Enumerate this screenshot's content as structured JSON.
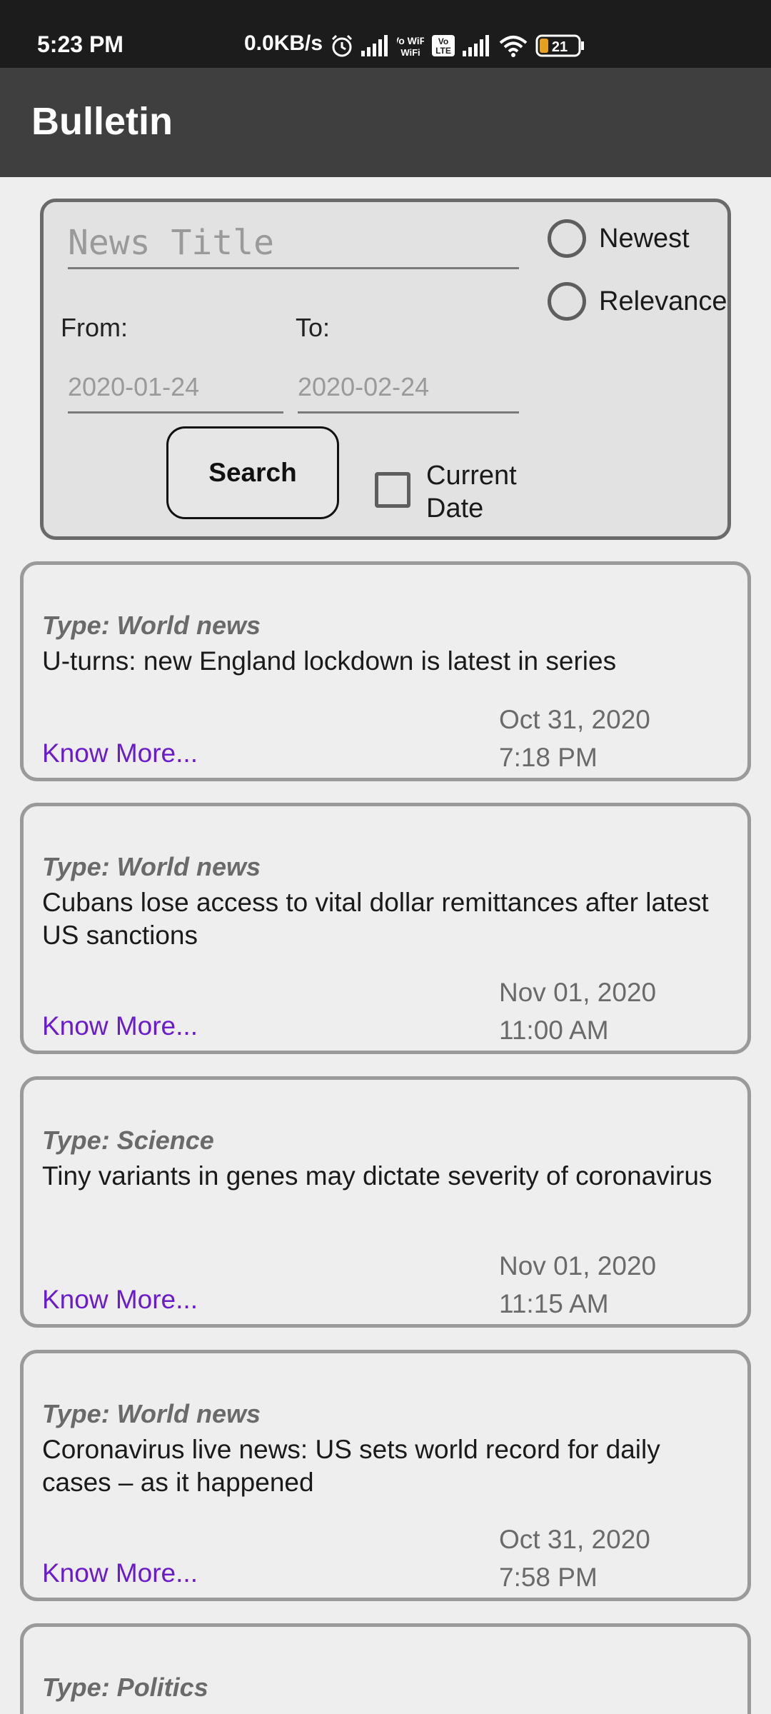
{
  "status_bar": {
    "time": "5:23 PM",
    "speed": "0.0KB/s",
    "icons": [
      "alarm-icon",
      "signal-icon",
      "vo-wifi-icon",
      "volte-icon",
      "signal-icon",
      "wifi-icon",
      "battery-icon"
    ],
    "vo_wifi": "Vo WiFi",
    "volte": "Vo LTE",
    "battery_level": "21"
  },
  "app_bar": {
    "title": "Bulletin"
  },
  "search": {
    "title_placeholder": "News Title",
    "sort_options": [
      "Newest",
      "Relevance"
    ],
    "from_label": "From:",
    "to_label": "To:",
    "from_placeholder": "2020-01-24",
    "to_placeholder": "2020-02-24",
    "search_label": "Search",
    "current_date_label": "Current Date"
  },
  "news": [
    {
      "type": "Type: World news",
      "title": "U-turns: new England lockdown is latest in series",
      "more": "Know More...",
      "date": "Oct 31, 2020",
      "time": "7:18 PM"
    },
    {
      "type": "Type: World news",
      "title": "Cubans lose access to vital dollar remittances after latest US sanctions",
      "more": "Know More...",
      "date": "Nov 01, 2020",
      "time": "11:00 AM"
    },
    {
      "type": "Type: Science",
      "title": "Tiny variants in genes may dictate severity of coronavirus",
      "more": "Know More...",
      "date": "Nov 01, 2020",
      "time": "11:15 AM"
    },
    {
      "type": "Type: World news",
      "title": "Coronavirus live news: US sets world record for daily cases – as it happened",
      "more": "Know More...",
      "date": "Oct 31, 2020",
      "time": "7:58 PM"
    },
    {
      "type": "Type: Politics",
      "title": ""
    }
  ],
  "colors": {
    "app_bar": "#3f3f3f",
    "status_bar": "#1c1c1c",
    "link": "#6a1ccc",
    "background": "#eeeeee"
  }
}
